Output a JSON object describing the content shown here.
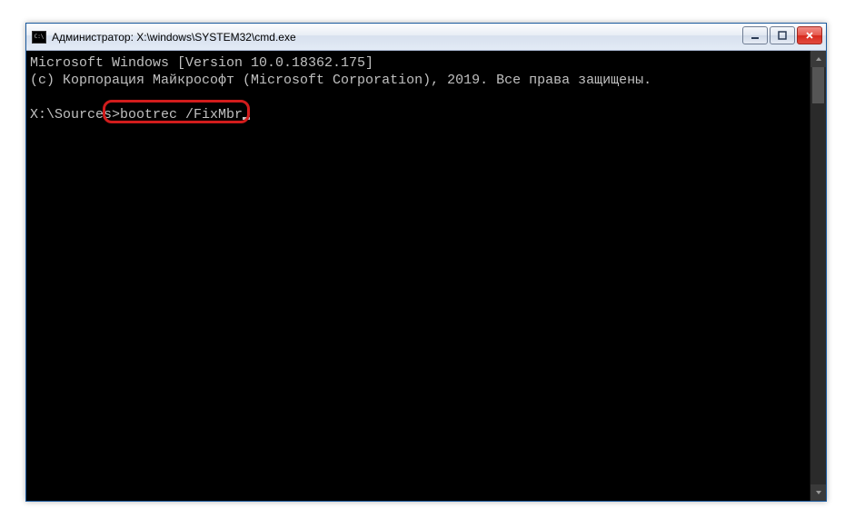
{
  "window": {
    "title": "Администратор: X:\\windows\\SYSTEM32\\cmd.exe"
  },
  "console": {
    "version_line": "Microsoft Windows [Version 10.0.18362.175]",
    "copyright_line": "(c) Корпорация Майкрософт (Microsoft Corporation), 2019. Все права защищены.",
    "prompt": "X:\\Sources>",
    "command": "bootrec /FixMbr"
  }
}
